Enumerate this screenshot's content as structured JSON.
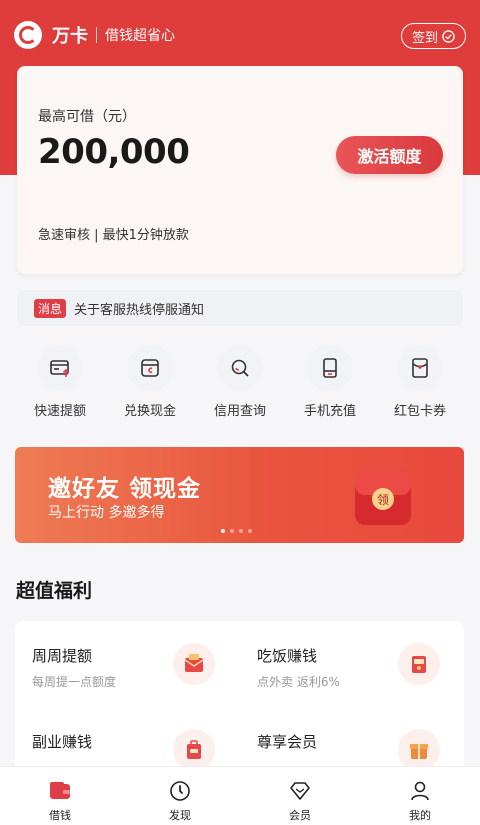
{
  "header": {
    "brand": "万卡",
    "slogan": "借钱超省心",
    "signin_label": "签到"
  },
  "credit": {
    "label": "最高可借（元）",
    "amount": "200,000",
    "activate_label": "激活额度",
    "subtitle": "急速审核 | 最快1分钟放款"
  },
  "notice": {
    "tag": "消息",
    "text": "关于客服热线停服通知"
  },
  "quick_actions": [
    {
      "label": "快速提额",
      "icon": "card-up-icon"
    },
    {
      "label": "兑换现金",
      "icon": "wallet-icon"
    },
    {
      "label": "信用查询",
      "icon": "search-icon"
    },
    {
      "label": "手机充值",
      "icon": "phone-icon"
    },
    {
      "label": "红包卡券",
      "icon": "red-envelope-icon"
    }
  ],
  "banner": {
    "title": "邀好友 领现金",
    "subtitle": "马上行动 多邀多得",
    "gift_text": "领",
    "active_dot": 0,
    "dot_count": 4
  },
  "benefits": {
    "title": "超值福利",
    "items": [
      {
        "title": "周周提额",
        "desc": "每周提一点额度",
        "icon": "envelope-icon"
      },
      {
        "title": "吃饭赚钱",
        "desc": "点外卖 返利6%",
        "icon": "food-icon"
      },
      {
        "title": "副业赚钱",
        "desc": "",
        "icon": "briefcase-icon"
      },
      {
        "title": "尊享会员",
        "desc": "",
        "icon": "gift-icon"
      }
    ]
  },
  "tabbar": [
    {
      "label": "借钱",
      "icon": "wallet-tab-icon",
      "active": true
    },
    {
      "label": "发现",
      "icon": "compass-icon",
      "active": false
    },
    {
      "label": "会员",
      "icon": "diamond-icon",
      "active": false
    },
    {
      "label": "我的",
      "icon": "user-icon",
      "active": false
    }
  ],
  "colors": {
    "brand": "#df3d3b",
    "accent": "#e03e46",
    "background": "#f6f6f8"
  }
}
